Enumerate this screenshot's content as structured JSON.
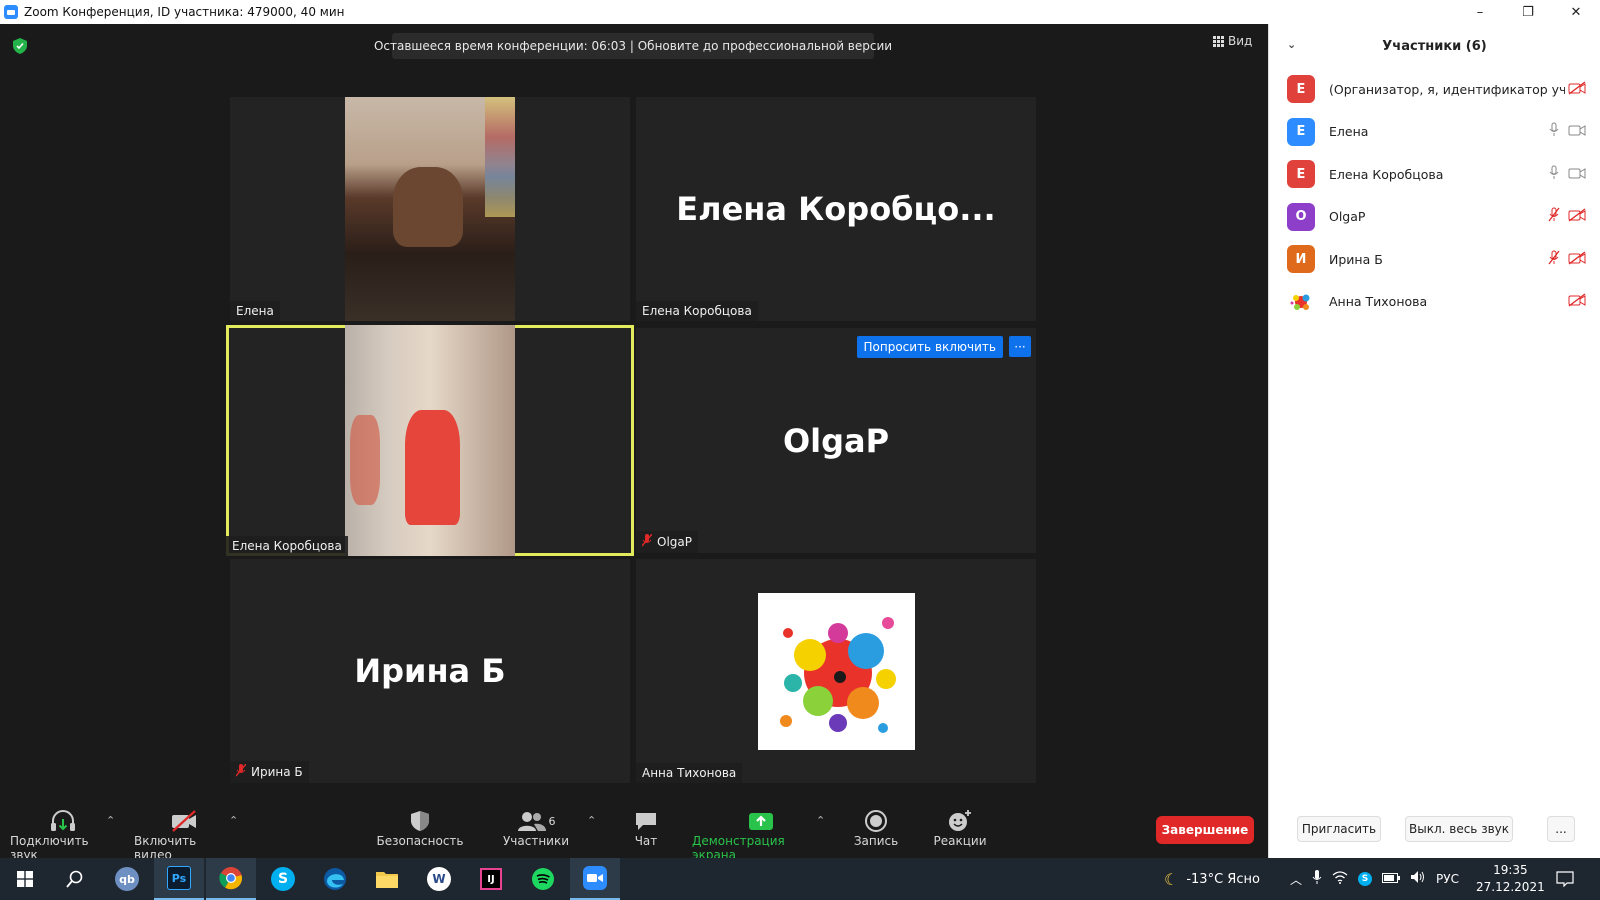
{
  "window": {
    "title": "Zoom Конференция, ID участника: 479000, 40 мин",
    "controls": {
      "minimize": "–",
      "maximize": "❐",
      "close": "✕"
    }
  },
  "meeting": {
    "banner": "Оставшееся время конференции: 06:03 | Обновите до профессиональной версии",
    "view_label": "Вид",
    "tiles": [
      {
        "name": "Елена",
        "type": "video"
      },
      {
        "name": "Елена Коробцова",
        "big_name": "Елена  Коробцо...",
        "type": "name"
      },
      {
        "name": "Елена Коробцова",
        "type": "video",
        "active": true
      },
      {
        "name": "OlgaP",
        "big_name": "OlgaP",
        "type": "name",
        "muted": true,
        "ask_label": "Попросить включить",
        "more_label": "···"
      },
      {
        "name": "Ирина Б",
        "big_name": "Ирина Б",
        "type": "name",
        "muted": true
      },
      {
        "name": "Анна Тихонова",
        "type": "picture"
      }
    ]
  },
  "toolbar": {
    "audio_label": "Подключить звук",
    "video_label": "Включить видео",
    "security_label": "Безопасность",
    "participants_label": "Участники",
    "participants_count": "6",
    "chat_label": "Чат",
    "share_label": "Демонстрация экрана",
    "record_label": "Запись",
    "reactions_label": "Реакции",
    "end_label": "Завершение",
    "caret": "⌃"
  },
  "panel": {
    "title": "Участники (6)",
    "participants": [
      {
        "initial": "Е",
        "name": "(Организатор, я, идентификатор участника)",
        "color": "#e0413a",
        "mic": "none",
        "cam": "off"
      },
      {
        "initial": "Е",
        "name": "Елена",
        "color": "#2d8cff",
        "mic": "on",
        "cam": "on"
      },
      {
        "initial": "Е",
        "name": "Елена Коробцова",
        "color": "#e0413a",
        "mic": "on",
        "cam": "on"
      },
      {
        "initial": "O",
        "name": "OlgaP",
        "color": "#8e3fc9",
        "mic": "off",
        "cam": "off"
      },
      {
        "initial": "И",
        "name": "Ирина Б",
        "color": "#e06a1b",
        "mic": "off",
        "cam": "off"
      },
      {
        "initial": "",
        "name": "Анна Тихонова",
        "color": "#ffffff",
        "mic": "none",
        "cam": "off"
      }
    ],
    "invite_label": "Пригласить",
    "mute_all_label": "Выкл. весь звук",
    "more_label": "..."
  },
  "taskbar": {
    "weather": "-13°C  Ясно",
    "lang": "РУС",
    "time": "19:35",
    "date": "27.12.2021",
    "apps": [
      "windows-start",
      "search",
      "qbittorrent",
      "photoshop",
      "chrome",
      "skype",
      "edge",
      "file-explorer",
      "wps",
      "intellij",
      "spotify",
      "zoom"
    ]
  }
}
